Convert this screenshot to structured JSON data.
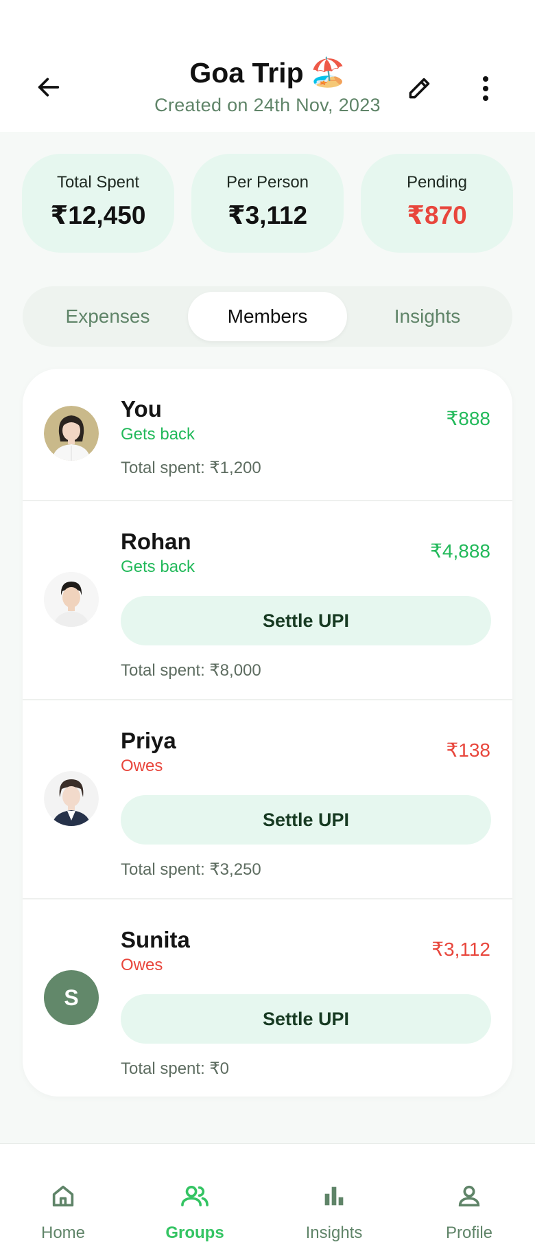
{
  "header": {
    "title": "Goa Trip",
    "title_emoji": "🏖️",
    "subtitle": "Created on 24th Nov, 2023",
    "back_icon": "arrow-left-icon",
    "edit_icon": "pencil-icon",
    "more_icon": "more-vertical-icon"
  },
  "stats": [
    {
      "label": "Total Spent",
      "value": "₹12,450"
    },
    {
      "label": "Per Person",
      "value": "₹3,112"
    },
    {
      "label": "Pending",
      "value": "₹870",
      "color": "#e8463c"
    }
  ],
  "tabs": [
    {
      "label": "Expenses",
      "active": false
    },
    {
      "label": "Members",
      "active": true
    },
    {
      "label": "Insights",
      "active": false
    }
  ],
  "members": [
    {
      "name": "You",
      "status": "Gets back",
      "status_type": "green",
      "amount": "₹888",
      "total": "Total spent: ₹1,200",
      "avatar": "woman-avatar"
    },
    {
      "name": "Rohan",
      "status": "Gets back",
      "status_type": "green",
      "amount": "₹4,888",
      "button": "Settle UPI",
      "total": "Total spent: ₹8,000",
      "avatar": "man-avatar"
    },
    {
      "name": "Priya",
      "status": "Owes",
      "status_type": "red",
      "amount": "₹138",
      "button": "Settle UPI",
      "total": "Total spent: ₹3,250",
      "avatar": "young-man-avatar"
    },
    {
      "name": "Sunita",
      "status": "Owes",
      "status_type": "red",
      "amount": "₹3,112",
      "button": "Settle UPI",
      "total": "Total spent: ₹0",
      "avatar_initial": "S"
    }
  ],
  "nav": [
    {
      "label": "Home",
      "icon": "home-icon",
      "active": false
    },
    {
      "label": "Groups",
      "icon": "groups-icon",
      "active": true
    },
    {
      "label": "Insights",
      "icon": "bar-chart-icon",
      "active": false
    },
    {
      "label": "Profile",
      "icon": "profile-icon",
      "active": false
    }
  ],
  "colors": {
    "accent_green": "#34c463",
    "positive": "#22b95a",
    "negative": "#e8463c",
    "muted_green": "#5f8468",
    "pill_bg": "#e6f7ef"
  }
}
